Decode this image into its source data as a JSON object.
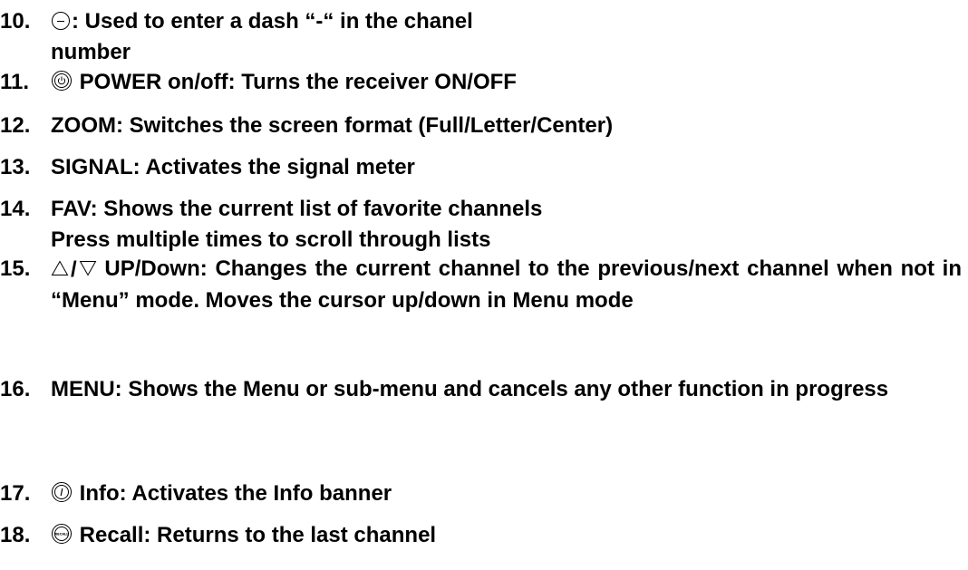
{
  "items": [
    {
      "number": "10.",
      "icon": "dash-button-icon",
      "lines": [
        ": Used to enter a dash “-“ in the chanel",
        "number"
      ]
    },
    {
      "number": "11.",
      "icon": "power-button-icon",
      "lines": [
        " POWER on/off: Turns the receiver ON/OFF"
      ]
    },
    {
      "number": "12.",
      "lines": [
        "ZOOM: Switches the screen format (Full/Letter/Center)"
      ]
    },
    {
      "number": "13.",
      "lines": [
        "SIGNAL: Activates the signal meter"
      ]
    },
    {
      "number": "14.",
      "lines": [
        "FAV: Shows the current list of favorite channels",
        "Press multiple times to scroll through lists"
      ]
    },
    {
      "number": "15.",
      "icon": "up-down-arrows-icon",
      "slash": "/",
      "lines": [
        " UP/Down: Changes the current channel to the previous/next channel when not in “Menu” mode. Moves the cursor up/down in Menu mode"
      ]
    },
    {
      "number": "16.",
      "lines": [
        "MENU: Shows the Menu or sub-menu and cancels any other function in progress"
      ]
    },
    {
      "number": "17.",
      "icon": "info-button-icon",
      "lines": [
        " Info: Activates the Info banner"
      ]
    },
    {
      "number": "18.",
      "icon": "recall-button-icon",
      "icon_text": "RECALL",
      "lines": [
        " Recall: Returns to the last channel"
      ]
    }
  ]
}
